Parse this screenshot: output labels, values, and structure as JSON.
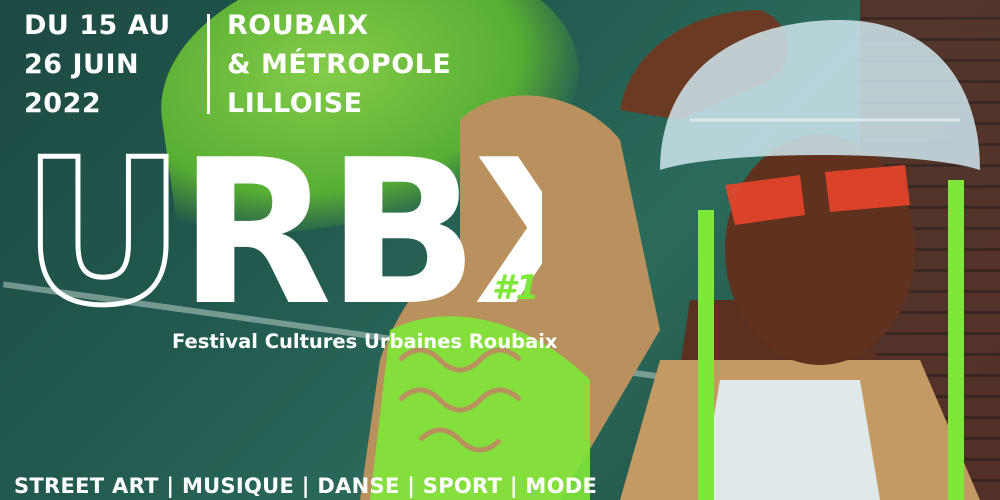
{
  "event": {
    "dates_lines": [
      "DU 15 AU",
      "26 JUIN",
      "2022"
    ],
    "place_lines": [
      "ROUBAIX",
      "& MÉTROPOLE",
      "LILLOISE"
    ],
    "logo_text": "URBX",
    "edition": "#1",
    "subtitle": "Festival Cultures Urbaines Roubaix",
    "disciplines": "STREET ART | MUSIQUE | DANSE | SPORT | MODE"
  },
  "colors": {
    "accent_green": "#7ee83a",
    "background": "#22594f",
    "text": "#ffffff"
  }
}
